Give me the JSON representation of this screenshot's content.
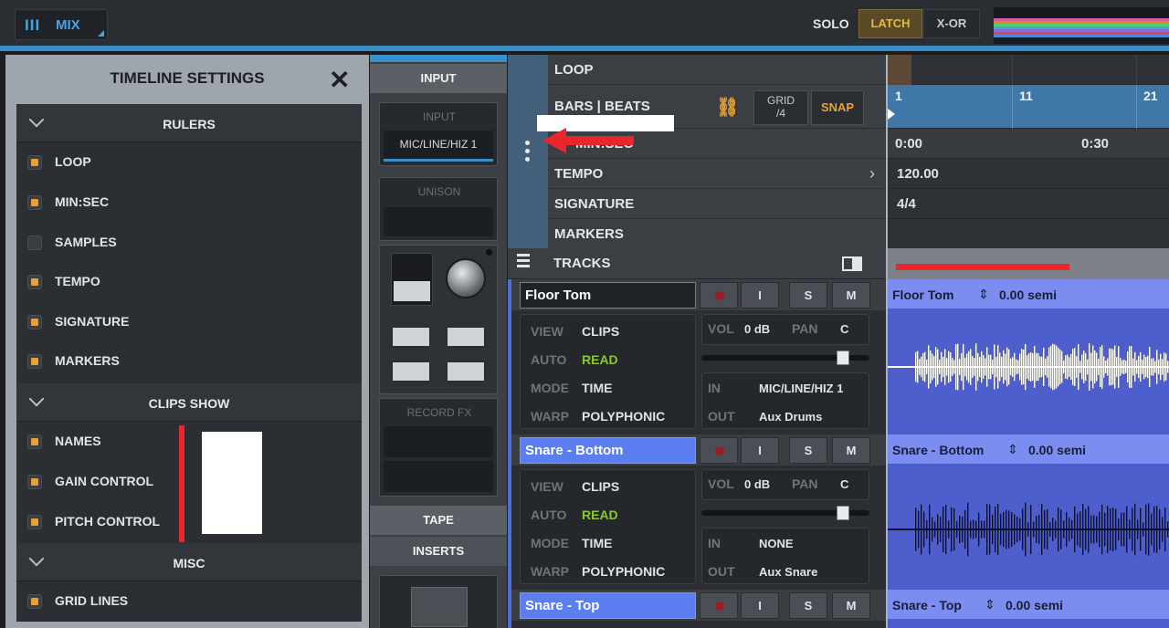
{
  "topbar": {
    "mix_label": "MIX",
    "mix_icon": "mixer-bars-icon",
    "solo_label": "SOLO",
    "latch_label": "LATCH",
    "xor_label": "X-OR"
  },
  "settings": {
    "title": "TIMELINE SETTINGS",
    "close_icon": "close-icon",
    "sections": [
      {
        "title": "RULERS",
        "items": [
          {
            "label": "LOOP",
            "checked": true
          },
          {
            "label": "MIN:SEC",
            "checked": true
          },
          {
            "label": "SAMPLES",
            "checked": false
          },
          {
            "label": "TEMPO",
            "checked": true
          },
          {
            "label": "SIGNATURE",
            "checked": true
          },
          {
            "label": "MARKERS",
            "checked": true
          }
        ]
      },
      {
        "title": "CLIPS SHOW",
        "items": [
          {
            "label": "NAMES",
            "checked": true
          },
          {
            "label": "GAIN CONTROL",
            "checked": true
          },
          {
            "label": "PITCH CONTROL",
            "checked": true
          }
        ]
      },
      {
        "title": "MISC",
        "items": [
          {
            "label": "GRID LINES",
            "checked": true
          }
        ]
      }
    ]
  },
  "channel_strip": {
    "input_header": "INPUT",
    "input_box_caption": "INPUT",
    "input_value": "MIC/LINE/HIZ 1",
    "unison_caption": "UNISON",
    "record_fx_caption": "RECORD FX",
    "tape_header": "TAPE",
    "inserts_header": "INSERTS"
  },
  "rulers": {
    "loop": "LOOP",
    "bars_beats": "BARS | BEATS",
    "min_sec": "MIN:SEC",
    "tempo": "TEMPO",
    "signature": "SIGNATURE",
    "markers": "MARKERS",
    "grid_label": "GRID",
    "grid_value": "/4",
    "snap_label": "SNAP",
    "bar_marks": [
      "1",
      "11",
      "21"
    ],
    "time_marks": [
      "0:00",
      "0:30"
    ],
    "tempo_value": "120.00",
    "signature_value": "4/4"
  },
  "tracks_header": {
    "label": "TRACKS"
  },
  "tracks": [
    {
      "name": "Floor Tom",
      "view": "CLIPS",
      "auto": "READ",
      "mode": "TIME",
      "warp": "POLYPHONIC",
      "vol": "0 dB",
      "pan": "C",
      "in": "MIC/LINE/HIZ 1",
      "out": "Aux Drums",
      "clip_name": "Floor Tom",
      "pitch": "0.00 semi",
      "selected_style": "dark",
      "fader_level": 0.84
    },
    {
      "name": "Snare - Bottom",
      "view": "CLIPS",
      "auto": "READ",
      "mode": "TIME",
      "warp": "POLYPHONIC",
      "vol": "0 dB",
      "pan": "C",
      "in": "NONE",
      "out": "Aux Snare",
      "clip_name": "Snare - Bottom",
      "pitch": "0.00 semi",
      "selected_style": "blue",
      "fader_level": 0.84
    },
    {
      "name": "Snare - Top",
      "clip_name": "Snare - Top",
      "pitch": "0.00 semi",
      "selected_style": "blue"
    }
  ],
  "track_keys": {
    "view": "VIEW",
    "auto": "AUTO",
    "mode": "MODE",
    "warp": "WARP",
    "vol": "VOL",
    "pan": "PAN",
    "in": "IN",
    "out": "OUT",
    "i": "I",
    "s": "S",
    "m": "M"
  },
  "colors": {
    "accent": "#3a8fc8",
    "checkbox_on": "#e8a135",
    "clip_blue": "#4e5ecd",
    "latch": "#e8b93c",
    "annotation_red": "#e8262b"
  }
}
